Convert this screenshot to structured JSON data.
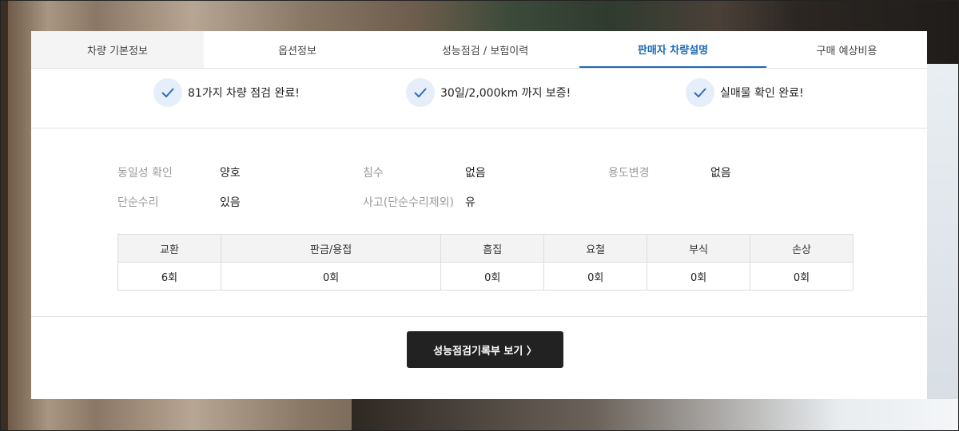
{
  "tabs": [
    {
      "label": "차량 기본정보"
    },
    {
      "label": "옵션정보"
    },
    {
      "label": "성능점검 / 보험이력"
    },
    {
      "label": "판매자 차량설명"
    },
    {
      "label": "구매 예상비용"
    }
  ],
  "active_tab": "판매자 차량설명",
  "checks": [
    {
      "text": "81가지 차량 점검 완료!",
      "icon": "check-icon"
    },
    {
      "text": "30일/2,000km 까지 보증!",
      "icon": "check-icon"
    },
    {
      "text": "실매물 확인 완료!",
      "icon": "check-icon"
    }
  ],
  "info": {
    "identity_label": "동일성 확인",
    "identity_value": "양호",
    "flood_label": "침수",
    "flood_value": "없음",
    "usage_label": "용도변경",
    "usage_value": "없음",
    "repair_label": "단순수리",
    "repair_value": "있음",
    "accident_label": "사고(단순수리제외)",
    "accident_value": "유"
  },
  "stats": {
    "headers": [
      "교환",
      "판금/용접",
      "흠집",
      "요철",
      "부식",
      "손상"
    ],
    "values": [
      "6회",
      "0회",
      "0회",
      "0회",
      "0회",
      "0회"
    ]
  },
  "button": {
    "label": "성능점검기록부 보기 〉"
  },
  "colors": {
    "accent": "#1b6bb6",
    "button_bg": "#222222",
    "check_circle": "#e6eef9"
  }
}
